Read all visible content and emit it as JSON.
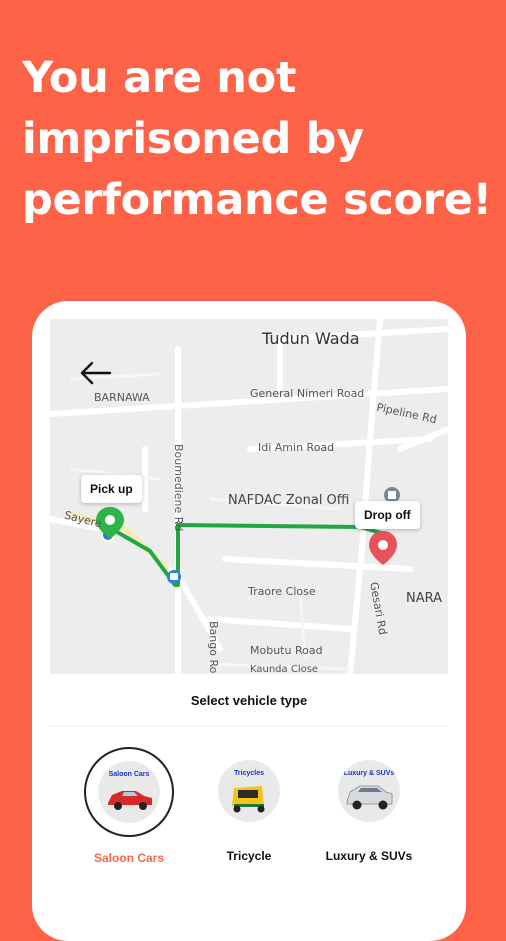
{
  "headline": {
    "lines": [
      "You are not",
      "imprisoned by",
      "performance score!"
    ]
  },
  "colors": {
    "background": "#FF6347",
    "route": "#22A745",
    "pickup_pin": "#2EB34A",
    "dropoff_pin": "#E8505B",
    "selected_label": "#FF6347"
  },
  "map": {
    "labels": {
      "tudun_wada": "Tudun Wada",
      "barnawa": "BARNAWA",
      "general_nimeri": "General Nimeri Road",
      "pipeline": "Pipeline Rd",
      "boumediene": "Boumediene Rd",
      "idi_amin": "Idi Amin Road",
      "nafdac": "NAFDAC Zonal Offi",
      "sayere": "Sayere",
      "traore": "Traore Close",
      "bango": "Bango Road",
      "mobutu": "Mobutu Road",
      "kaunda": "Kaunda Close",
      "gesari": "Gesari Rd",
      "nara": "NARA"
    },
    "pickup_label": "Pick up",
    "dropoff_label": "Drop off",
    "icons": [
      "back-arrow-icon",
      "bus-stop-icon",
      "building-icon",
      "pickup-pin-icon",
      "dropoff-pin-icon"
    ]
  },
  "sheet": {
    "title": "Select vehicle type",
    "vehicles": [
      {
        "label": "Saloon Cars",
        "tag": "Saloon Cars",
        "selected": true,
        "icon": "saloon-car-icon"
      },
      {
        "label": "Tricycle",
        "tag": "Tricycles",
        "selected": false,
        "icon": "tricycle-icon"
      },
      {
        "label": "Luxury & SUVs",
        "tag": "Luxury & SUVs",
        "selected": false,
        "icon": "suv-icon"
      }
    ]
  }
}
